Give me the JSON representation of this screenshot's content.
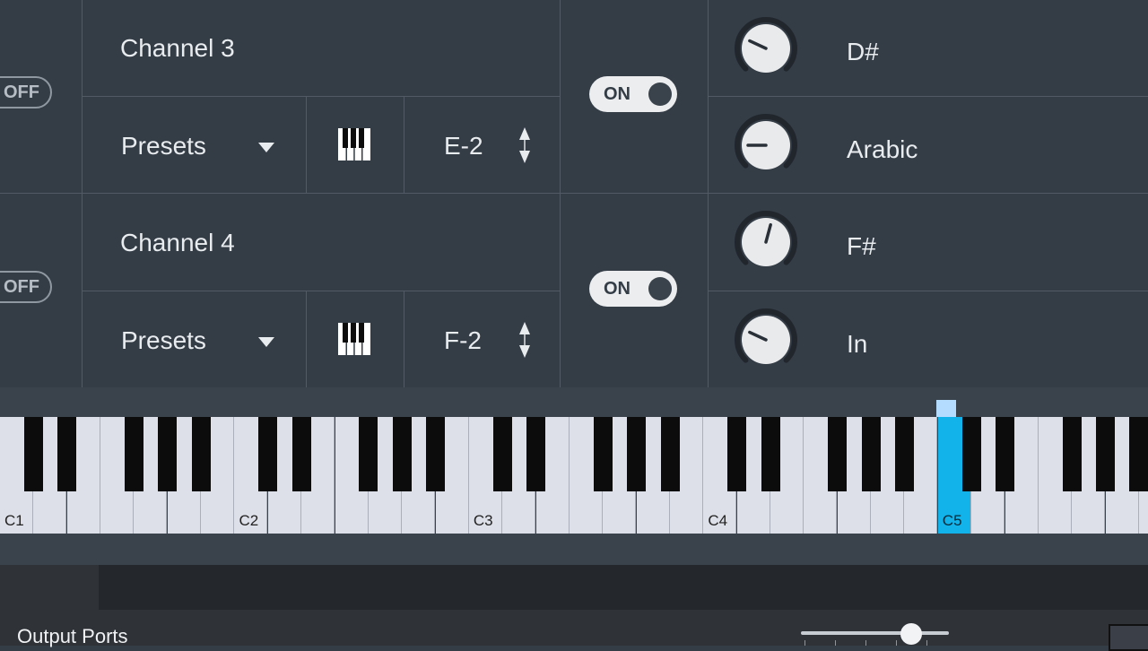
{
  "channels": [
    {
      "id": "channel-3",
      "name": "Channel 3",
      "mute_toggle": "OFF",
      "enable_toggle": "ON",
      "preset_label": "Presets",
      "note": "E-2",
      "knobs": [
        {
          "label": "D#",
          "angle": -65
        },
        {
          "label": "Arabic",
          "angle": -90
        }
      ]
    },
    {
      "id": "channel-4",
      "name": "Channel 4",
      "mute_toggle": "OFF",
      "enable_toggle": "ON",
      "preset_label": "Presets",
      "note": "F-2",
      "knobs": [
        {
          "label": "F#",
          "angle": 15
        },
        {
          "label": "In",
          "angle": -65
        }
      ]
    }
  ],
  "piano": {
    "octave_labels": [
      "C1",
      "C2",
      "C3",
      "C4",
      "C5"
    ],
    "active_key": "C5"
  },
  "footer": {
    "title": "Output Ports",
    "slider_value": 0.75
  },
  "colors": {
    "panel_bg": "#343c46",
    "grid_line": "#515a65",
    "active_key": "#12b2ea",
    "active_marker": "#b4dcff"
  },
  "icons": {
    "preset_dropdown": "caret-down-icon",
    "keyboard": "piano-keys-icon",
    "stepper": "up-down-arrows-icon"
  }
}
